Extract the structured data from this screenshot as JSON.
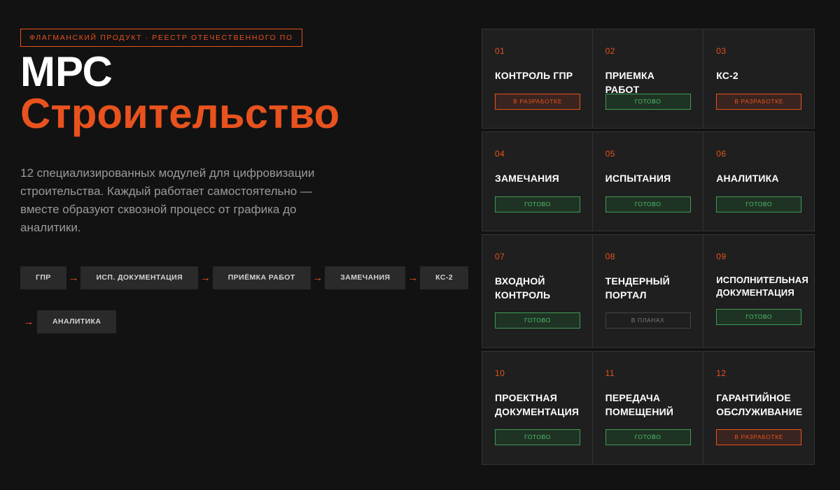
{
  "header": {
    "badge": "ФЛАГМАНСКИЙ ПРОДУКТ · РЕЕСТР ОТЕЧЕСТВЕННОГО ПО",
    "title_line1": "МРС",
    "title_line2": "Строительство",
    "description": "12 специализированных модулей для цифровизации строительства. Каждый работает самостоятельно — вместе образуют сквозной процесс от графика до аналитики."
  },
  "flow": {
    "arrow": "→",
    "row1": [
      "ГПР",
      "ИСП. ДОКУМЕНТАЦИЯ",
      "ПРИЁМКА РАБОТ",
      "ЗАМЕЧАНИЯ",
      "КС-2"
    ],
    "row2": [
      "АНАЛИТИКА"
    ]
  },
  "modules": [
    {
      "num": "01",
      "name": "КОНТРОЛЬ ГПР",
      "status": "В РАЗРАБОТКЕ",
      "kind": "dev"
    },
    {
      "num": "02",
      "name": "ПРИЕМКА РАБОТ",
      "status": "ГОТОВО",
      "kind": "ready"
    },
    {
      "num": "03",
      "name": "КС-2",
      "status": "В РАЗРАБОТКЕ",
      "kind": "dev"
    },
    {
      "num": "04",
      "name": "ЗАМЕЧАНИЯ",
      "status": "ГОТОВО",
      "kind": "ready"
    },
    {
      "num": "05",
      "name": "ИСПЫТАНИЯ",
      "status": "ГОТОВО",
      "kind": "ready"
    },
    {
      "num": "06",
      "name": "АНАЛИТИКА",
      "status": "ГОТОВО",
      "kind": "ready"
    },
    {
      "num": "07",
      "name": "ВХОДНОЙ КОНТРОЛЬ",
      "status": "ГОТОВО",
      "kind": "ready"
    },
    {
      "num": "08",
      "name": "ТЕНДЕРНЫЙ ПОРТАЛ",
      "status": "В ПЛАНАХ",
      "kind": "plan"
    },
    {
      "num": "09",
      "name": "ИСПОЛНИТЕЛЬНАЯ ДОКУМЕНТАЦИЯ",
      "status": "ГОТОВО",
      "kind": "ready"
    },
    {
      "num": "10",
      "name": "ПРОЕКТНАЯ ДОКУМЕНТАЦИЯ",
      "status": "ГОТОВО",
      "kind": "ready"
    },
    {
      "num": "11",
      "name": "ПЕРЕДАЧА ПОМЕЩЕНИЙ",
      "status": "ГОТОВО",
      "kind": "ready"
    },
    {
      "num": "12",
      "name": "ГАРАНТИЙНОЕ ОБСЛУЖИВАНИЕ",
      "status": "В РАЗРАБОТКЕ",
      "kind": "dev"
    }
  ],
  "colors": {
    "accent": "#e8521e",
    "ready": "#4fc06a",
    "background": "#121212"
  }
}
